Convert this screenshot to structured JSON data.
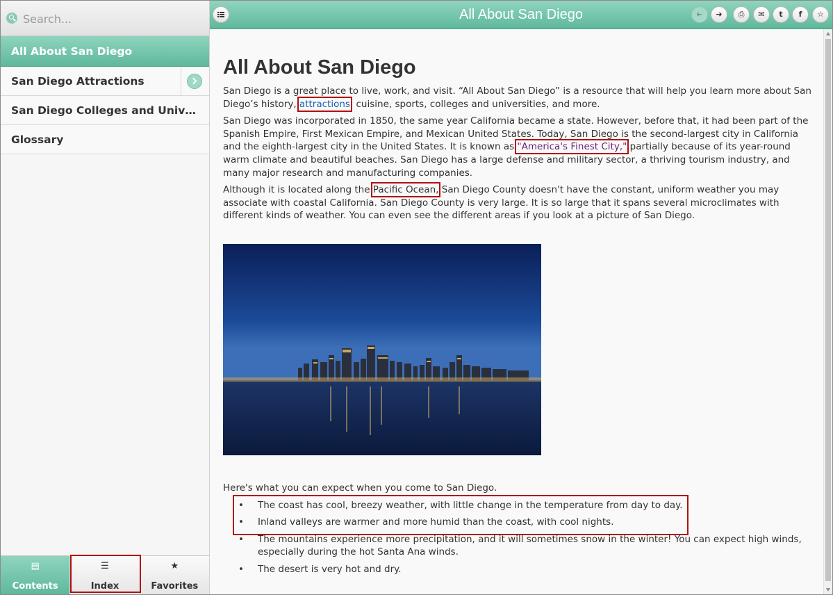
{
  "sidebar": {
    "search": {
      "placeholder": "Search..."
    },
    "items": [
      {
        "label": "All About San Diego",
        "active": true
      },
      {
        "label": "San Diego Attractions",
        "has_children": true
      },
      {
        "label": "San Diego Colleges and Universities"
      },
      {
        "label": "Glossary"
      }
    ],
    "tabs": [
      {
        "label": "Contents",
        "icon": "book-icon",
        "glyph": "▤",
        "active": true
      },
      {
        "label": "Index",
        "icon": "list-icon",
        "glyph": "☰"
      },
      {
        "label": "Favorites",
        "icon": "star-icon",
        "glyph": "★"
      }
    ]
  },
  "header": {
    "title": "All About San Diego",
    "buttons": [
      {
        "name": "back-icon",
        "glyph": "➜",
        "disabled": true
      },
      {
        "name": "forward-icon",
        "glyph": "➜"
      },
      {
        "name": "print-icon",
        "glyph": "⎙"
      },
      {
        "name": "email-icon",
        "glyph": "✉"
      },
      {
        "name": "twitter-icon",
        "glyph": "t"
      },
      {
        "name": "facebook-icon",
        "glyph": "f"
      },
      {
        "name": "favorite-star-icon",
        "glyph": "☆"
      }
    ]
  },
  "content": {
    "title": "All About San Diego",
    "p1_before": "San Diego is a great place to live, work, and visit. “All About San Diego” is a resource that will help you learn more about San Diego’s history, ",
    "p1_link": "attractions",
    "p1_after": ", cuisine, sports, colleges and universities, and more.",
    "p2_before": "San Diego was incorporated in 1850, the same year California became a state. However, before that, it had been part of the Spanish Empire, First Mexican Empire, and Mexican United States. Today, San Diego is the second-largest city in California and the eighth-largest city in the United States. It is known as ",
    "p2_link": "\"America's Finest City,\"",
    "p2_after": " partially because of its year-round warm climate and beautiful beaches. San Diego has a large defense and military sector, a thriving tourism industry, and many major research and manufacturing companies.",
    "p3_before": "Although it is located along the ",
    "p3_term": "Pacific Ocean,",
    "p3_after": " San Diego County doesn't have the constant, uniform weather you may associate with coastal California. San Diego County is very large. It is so large that it spans several microclimates with different kinds of weather. You can even see the different areas if you look at a picture of San Diego.",
    "intro": "Here's what you can expect when you come to San Diego.",
    "bullets": [
      "The coast has cool, breezy weather, with little change in the temperature from day to day.",
      "Inland valleys are warmer and more humid than the coast, with cool nights.",
      "The mountains experience more precipitation, and it will sometimes snow in the winter! You can expect high winds, especially during the hot Santa Ana winds.",
      "The desert is very hot and dry."
    ]
  }
}
